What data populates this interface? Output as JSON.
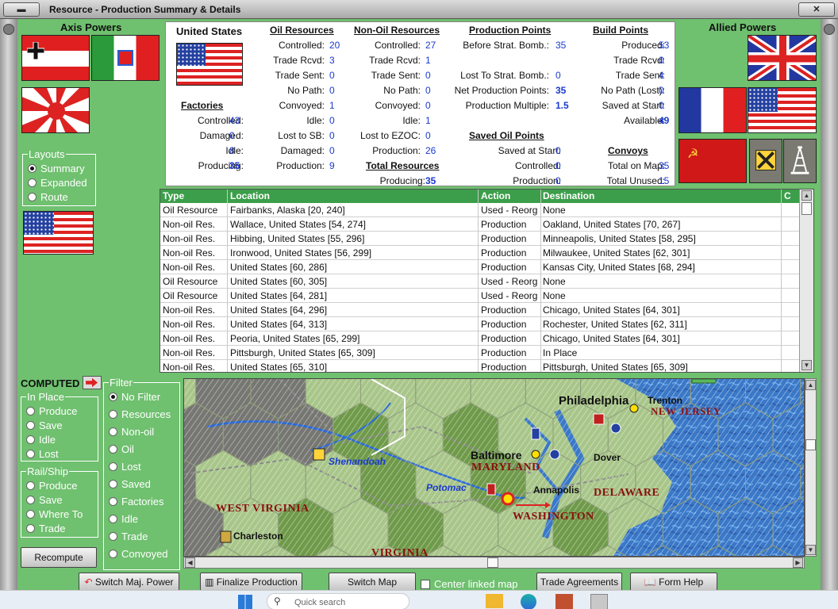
{
  "window": {
    "title": "Resource - Production Summary & Details"
  },
  "axis": {
    "header": "Axis Powers"
  },
  "allied": {
    "header": "Allied Powers"
  },
  "layouts": {
    "legend": "Layouts",
    "options": [
      "Summary",
      "Expanded",
      "Route"
    ],
    "selected": "Summary"
  },
  "summary": {
    "country": "United States",
    "factories": {
      "title": "Factories",
      "rows": [
        {
          "label": "Controlled:",
          "value": "43"
        },
        {
          "label": "Damaged:",
          "value": "0"
        },
        {
          "label": "Idle:",
          "value": "8"
        },
        {
          "label": "Producing:",
          "value": "35",
          "bold": true
        }
      ]
    },
    "oil": {
      "title": "Oil Resources",
      "rows": [
        {
          "label": "Controlled:",
          "value": "20"
        },
        {
          "label": "Trade Rcvd:",
          "value": "3"
        },
        {
          "label": "Trade Sent:",
          "value": "0"
        },
        {
          "label": "No Path:",
          "value": "0"
        },
        {
          "label": "Convoyed:",
          "value": "1"
        },
        {
          "label": "Idle:",
          "value": "0"
        },
        {
          "label": "Lost to SB:",
          "value": "0"
        },
        {
          "label": "Damaged:",
          "value": "0"
        },
        {
          "label": "Production:",
          "value": "9"
        }
      ]
    },
    "nonoil": {
      "title": "Non-Oil Resources",
      "rows": [
        {
          "label": "Controlled:",
          "value": "27"
        },
        {
          "label": "Trade Rcvd:",
          "value": "1"
        },
        {
          "label": "Trade Sent:",
          "value": "0"
        },
        {
          "label": "No Path:",
          "value": "0"
        },
        {
          "label": "Convoyed:",
          "value": "0"
        },
        {
          "label": "Idle:",
          "value": "1"
        },
        {
          "label": "Lost to EZOC:",
          "value": "0"
        },
        {
          "label": "Production:",
          "value": "26"
        }
      ]
    },
    "total": {
      "title": "Total Resources",
      "label": "Producing:",
      "value": "35"
    },
    "pp": {
      "title": "Production Points",
      "rows": [
        {
          "label": "Before Strat. Bomb.:",
          "value": "35"
        },
        {
          "label": "Lost To Strat. Bomb.:",
          "value": "0"
        },
        {
          "label": "Net Production Points:",
          "value": "35",
          "bold": true
        },
        {
          "label": "Production Multiple:",
          "value": "1.5",
          "bold": true
        }
      ]
    },
    "saved": {
      "title": "Saved Oil Points",
      "rows": [
        {
          "label": "Saved at Start:",
          "value": "0"
        },
        {
          "label": "Controlled:",
          "value": "0"
        },
        {
          "label": "Production:",
          "value": "0"
        }
      ]
    },
    "build": {
      "title": "Build Points",
      "rows": [
        {
          "label": "Produced:",
          "value": "53"
        },
        {
          "label": "Trade Rcvd:",
          "value": "0"
        },
        {
          "label": "Trade Sent:",
          "value": "4"
        },
        {
          "label": "No Path (Lost):",
          "value": "0"
        },
        {
          "label": "Saved at Start:",
          "value": "0"
        },
        {
          "label": "Available:",
          "value": "49",
          "bold": true
        }
      ]
    },
    "convoys": {
      "title": "Convoys",
      "rows": [
        {
          "label": "Total on Map:",
          "value": "35"
        },
        {
          "label": "Total Unused:",
          "value": "15"
        }
      ]
    }
  },
  "table": {
    "headers": [
      "Type",
      "Location",
      "Action",
      "Destination",
      "C"
    ],
    "rows": [
      [
        "Oil Resource",
        "Fairbanks, Alaska [20, 240]",
        "Used - Reorg",
        "None"
      ],
      [
        "Non-oil Res.",
        "Wallace, United States [54, 274]",
        "Production",
        "Oakland, United States [70, 267]"
      ],
      [
        "Non-oil Res.",
        "Hibbing, United States [55, 296]",
        "Production",
        "Minneapolis, United States [58, 295]"
      ],
      [
        "Non-oil Res.",
        "Ironwood, United States [56, 299]",
        "Production",
        "Milwaukee, United States [62, 301]"
      ],
      [
        "Non-oil Res.",
        "United States [60, 286]",
        "Production",
        "Kansas City, United States [68, 294]"
      ],
      [
        "Oil Resource",
        "United States [60, 305]",
        "Used - Reorg",
        "None"
      ],
      [
        "Oil Resource",
        "United States [64, 281]",
        "Used - Reorg",
        "None"
      ],
      [
        "Non-oil Res.",
        "United States [64, 296]",
        "Production",
        "Chicago, United States [64, 301]"
      ],
      [
        "Non-oil Res.",
        "United States [64, 313]",
        "Production",
        "Rochester, United States [62, 311]"
      ],
      [
        "Non-oil Res.",
        "Peoria, United States [65, 299]",
        "Production",
        "Chicago, United States [64, 301]"
      ],
      [
        "Non-oil Res.",
        "Pittsburgh, United States [65, 309]",
        "Production",
        "In Place"
      ],
      [
        "Non-oil Res.",
        "United States [65, 310]",
        "Production",
        "Pittsburgh, United States [65, 309]"
      ]
    ]
  },
  "computed": {
    "label": "COMPUTED"
  },
  "inplace": {
    "legend": "In Place",
    "options": [
      "Produce",
      "Save",
      "Idle",
      "Lost"
    ]
  },
  "railship": {
    "legend": "Rail/Ship",
    "options": [
      "Produce",
      "Save",
      "Where To",
      "Trade"
    ]
  },
  "filter": {
    "legend": "Filter",
    "options": [
      "No Filter",
      "Resources",
      "Non-oil",
      "Oil",
      "Lost",
      "Saved",
      "Factories",
      "Idle",
      "Trade",
      "Convoyed"
    ],
    "selected": "No Filter"
  },
  "buttons": {
    "recompute": "Recompute",
    "switch_power": "Switch Maj. Power",
    "finalize": "Finalize Production",
    "switch_map": "Switch Map",
    "center_linked": "Center linked map",
    "trade_agreements": "Trade Agreements",
    "form_help": "Form Help"
  },
  "map": {
    "labels": [
      {
        "text": "Philadelphia",
        "kind": "city"
      },
      {
        "text": "Trenton",
        "kind": "city"
      },
      {
        "text": "NEW JERSEY",
        "kind": "state"
      },
      {
        "text": "Shenandoah",
        "kind": "river"
      },
      {
        "text": "Baltimore",
        "kind": "city"
      },
      {
        "text": "MARYLAND",
        "kind": "state"
      },
      {
        "text": "Dover",
        "kind": "city"
      },
      {
        "text": "Potomac",
        "kind": "river"
      },
      {
        "text": "Annapolis",
        "kind": "city"
      },
      {
        "text": "DELAWARE",
        "kind": "state"
      },
      {
        "text": "WEST VIRGINIA",
        "kind": "state"
      },
      {
        "text": "WASHINGTON",
        "kind": "state"
      },
      {
        "text": "Charleston",
        "kind": "city"
      },
      {
        "text": "VIRGINIA",
        "kind": "state"
      }
    ]
  },
  "taskbar": {
    "search_placeholder": "Quick search"
  },
  "colors": {
    "table_header": "#3c9e4a",
    "panel_bg": "#6fc06f",
    "value_blue": "#1a3ad0",
    "state_label": "#8a1010"
  }
}
